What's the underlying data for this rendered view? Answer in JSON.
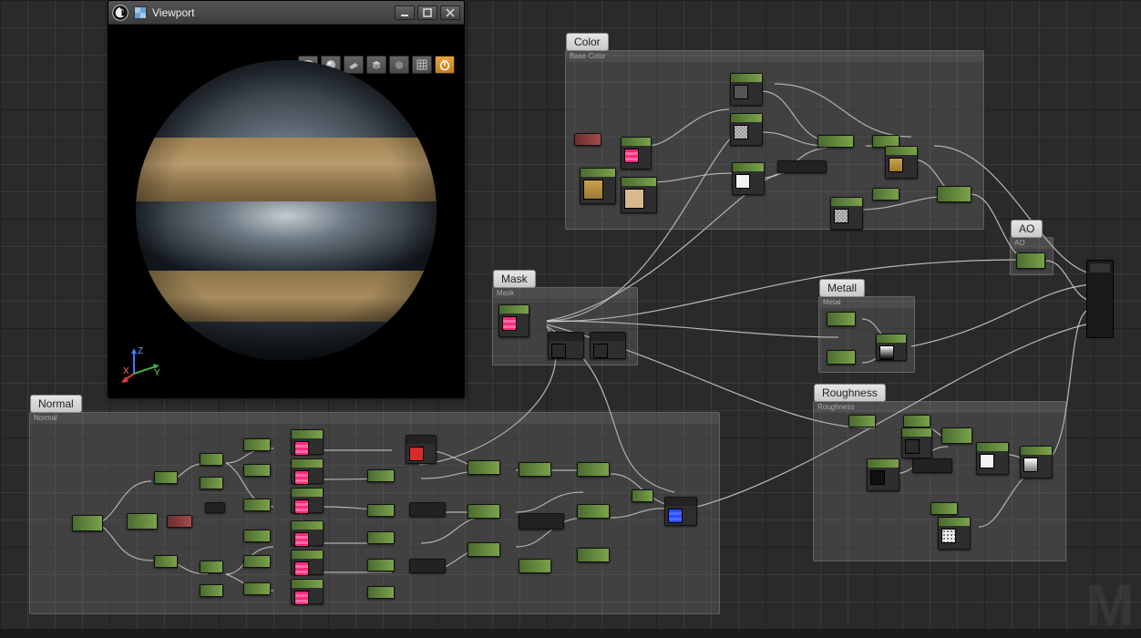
{
  "viewport": {
    "title": "Viewport",
    "axes": {
      "x": "X",
      "y": "Y",
      "z": "Z"
    }
  },
  "window_controls": {
    "minimize": "min",
    "maximize": "max",
    "close": "close"
  },
  "toolbar": {
    "items": [
      "lit-cube",
      "lit-sphere",
      "plane",
      "cube",
      "cylinder",
      "grid",
      "time"
    ]
  },
  "regions": {
    "color": {
      "label": "Color",
      "tab": "Base Color"
    },
    "mask": {
      "label": "Mask",
      "tab": "Mask"
    },
    "ao": {
      "label": "AO",
      "tab": "AO"
    },
    "metal": {
      "label": "Metall",
      "tab": "Metal"
    },
    "roughness": {
      "label": "Roughness",
      "tab": "Roughness"
    },
    "normal": {
      "label": "Normal",
      "tab": "Normal"
    }
  },
  "watermark": "M"
}
